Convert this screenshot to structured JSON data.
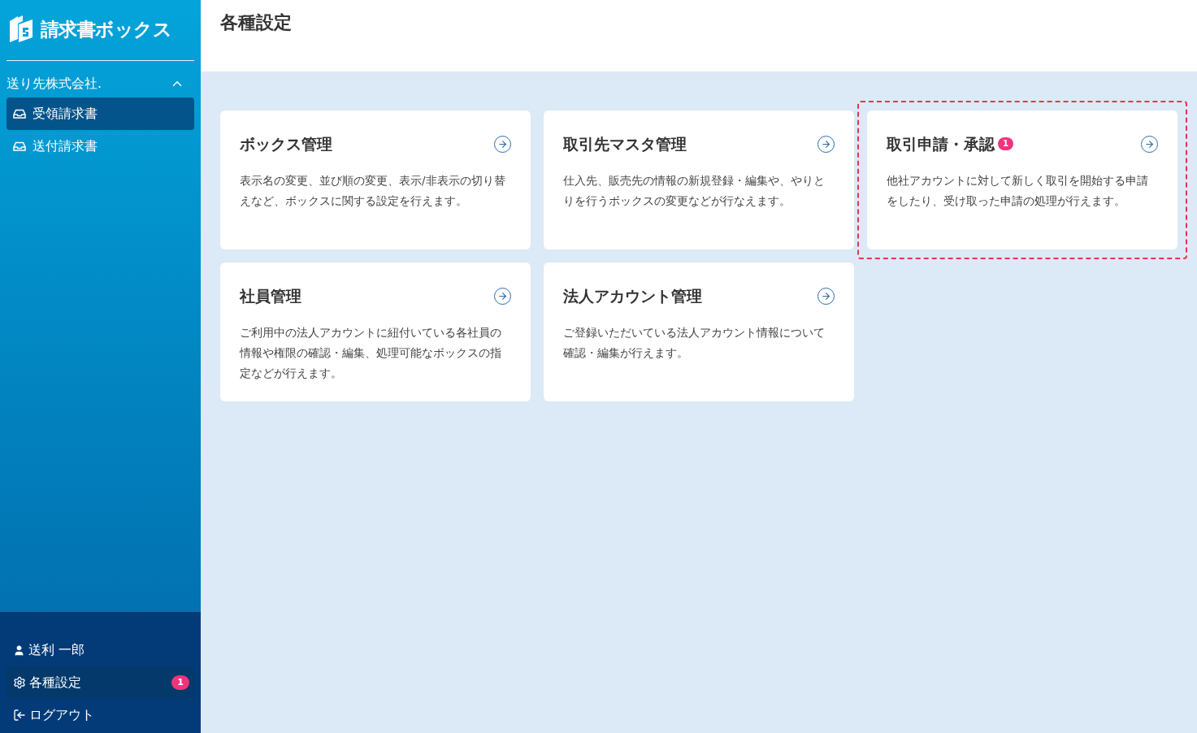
{
  "sidebar": {
    "logo": "請求書ボックス",
    "section": {
      "title": "送り先株式会社.",
      "expanded": true
    },
    "items": [
      {
        "label": "受領請求書",
        "selected": true
      },
      {
        "label": "送付請求書",
        "selected": false
      }
    ],
    "footer": [
      {
        "kind": "user",
        "label": "送利 一郎",
        "selected": false
      },
      {
        "kind": "settings",
        "label": "各種設定",
        "selected": true,
        "badge": "1"
      },
      {
        "kind": "logout",
        "label": "ログアウト",
        "selected": false
      }
    ]
  },
  "page": {
    "title": "各種設定"
  },
  "cards": [
    {
      "title": "ボックス管理",
      "description": "表示名の変更、並び順の変更、表示/非表示の切り替えなど、ボックスに関する設定を行えます。",
      "highlighted": false
    },
    {
      "title": "取引先マスタ管理",
      "description": "仕入先、販売先の情報の新規登録・編集や、やりとりを行うボックスの変更などが行なえます。",
      "highlighted": false
    },
    {
      "title": "取引申請・承認",
      "badge": "1",
      "description": "他社アカウントに対して新しく取引を開始する申請をしたり、受け取った申請の処理が行えます。",
      "highlighted": true
    },
    {
      "title": "社員管理",
      "description": "ご利用中の法人アカウントに紐付いている各社員の情報や権限の確認・編集、処理可能なボックスの指定などが行えます。",
      "highlighted": false
    },
    {
      "title": "法人アカウント管理",
      "description": "ご登録いただいている法人アカウント情報について確認・編集が行えます。",
      "highlighted": false
    }
  ]
}
